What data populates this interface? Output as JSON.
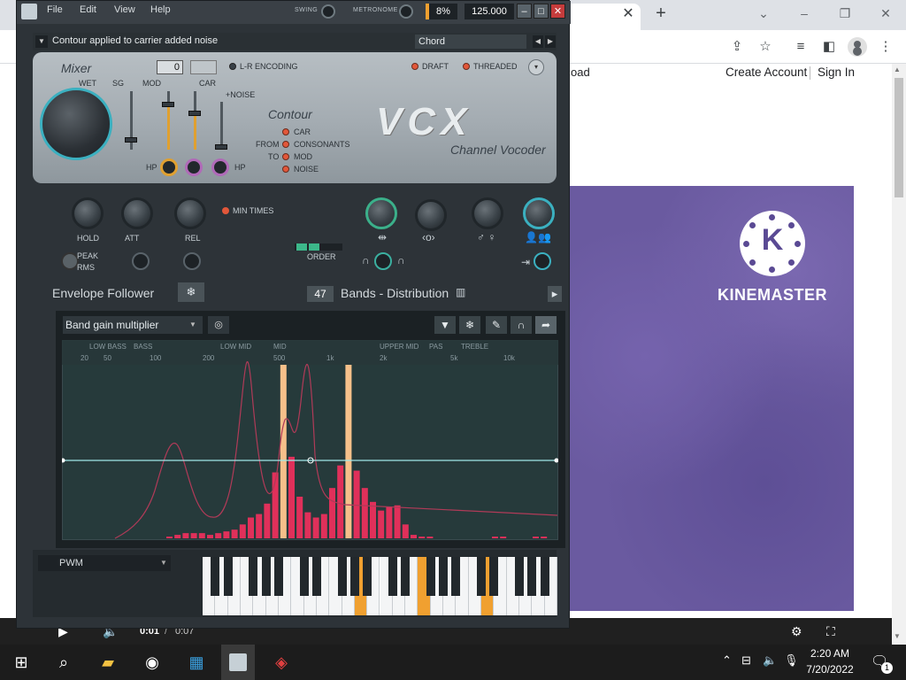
{
  "browser": {
    "page_fragment": "oad",
    "create_account": "Create Account",
    "sign_in": "Sign In",
    "video": {
      "brand": "KINEMASTER",
      "logo_letter": "K",
      "current_time": "0:01",
      "separator": "/",
      "duration": "0:07"
    }
  },
  "fl": {
    "menu": [
      "File",
      "Edit",
      "View",
      "Help"
    ],
    "swing_label": "SWING",
    "metronome_label": "METRONOME",
    "cpu": "8%",
    "tempo": "125.000",
    "plugin_title": "Contour applied to carrier added noise",
    "preset": "Chord",
    "mixer": {
      "title": "Mixer",
      "wet": "WET",
      "sg": "SG",
      "mod": "MOD",
      "car": "CAR",
      "noise": "+NOISE",
      "value": "0",
      "lr_encoding": "L-R ENCODING",
      "draft": "DRAFT",
      "threaded": "THREADED",
      "hp1": "HP",
      "hp2": "HP"
    },
    "contour": {
      "title": "Contour",
      "from": "FROM",
      "to": "TO",
      "options": [
        "CAR",
        "CONSONANTS",
        "MOD",
        "NOISE"
      ]
    },
    "brand": {
      "logo": "VCX",
      "subtitle": "Channel Vocoder"
    },
    "envelope": {
      "hold": "HOLD",
      "att": "ATT",
      "rel": "REL",
      "min_times": "MIN TIMES",
      "peak": "PEAK",
      "rms": "RMS",
      "order": "ORDER",
      "title": "Envelope Follower",
      "bands_count": "47",
      "bands_label": "Bands - Distribution"
    },
    "editor": {
      "dropdown": "Band gain multiplier",
      "ranges": [
        "LOW BASS",
        "BASS",
        "LOW MID",
        "MID",
        "UPPER MID",
        "PAS",
        "TREBLE"
      ],
      "freqs": [
        "20",
        "50",
        "100",
        "200",
        "500",
        "1k",
        "2k",
        "5k",
        "10k"
      ]
    },
    "bottom": {
      "wave": "PWM"
    }
  },
  "chart_data": {
    "type": "bar",
    "title": "",
    "series": [
      {
        "values": [
          0.01,
          0.02,
          0.03,
          0.03,
          0.03,
          0.02,
          0.03,
          0.04,
          0.05,
          0.08,
          0.12,
          0.14,
          0.2,
          0.38,
          1.0,
          0.47,
          0.24,
          0.15,
          0.12,
          0.14,
          0.29,
          0.42,
          1.0,
          0.39,
          0.29,
          0.21,
          0.16,
          0.18,
          0.19,
          0.08,
          0.02,
          0.01,
          0.01,
          0.0,
          0.0,
          0.0,
          0.0,
          0.0,
          0.0,
          0.0,
          0.01,
          0.01,
          0.0,
          0.0,
          0.0,
          0.01,
          0.01
        ]
      }
    ],
    "highlight_bands": [
      14,
      22
    ],
    "gain_line": 0.5
  },
  "taskbar": {
    "time": "2:20 AM",
    "date": "7/20/2022",
    "notifications": "1"
  },
  "colors": {
    "accent": "#f0a030",
    "bar": "#e0305a",
    "teal": "#3bb0c0",
    "led": "#e2573a"
  }
}
